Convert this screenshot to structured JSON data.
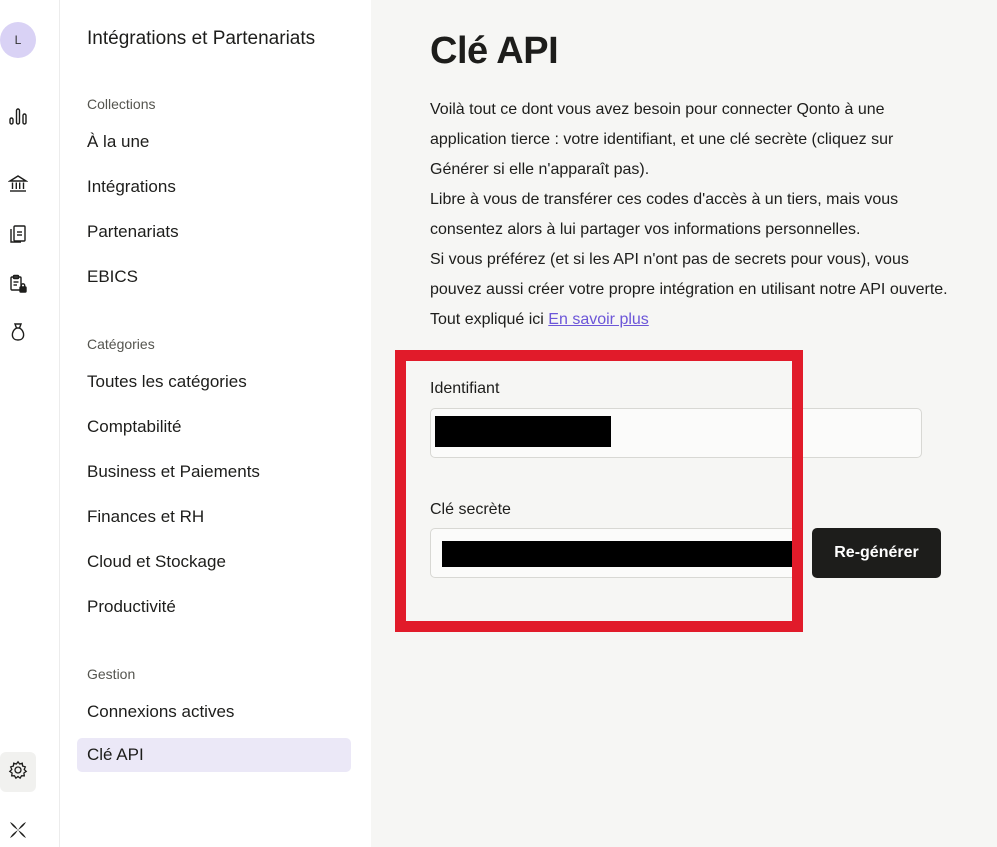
{
  "rail": {
    "avatar_initial": "L",
    "icons": [
      "bar-chart-icon",
      "bank-icon",
      "documents-icon",
      "locked-clipboard-icon",
      "money-bag-icon",
      "gear-icon",
      "qonto-logo-icon"
    ]
  },
  "nav": {
    "heading": "Intégrations et Partenariats",
    "sections": [
      {
        "title": "Collections",
        "items": [
          "À la une",
          "Intégrations",
          "Partenariats",
          "EBICS"
        ]
      },
      {
        "title": "Catégories",
        "items": [
          "Toutes les catégories",
          "Comptabilité",
          "Business et Paiements",
          "Finances et RH",
          "Cloud et Stockage",
          "Productivité"
        ]
      },
      {
        "title": "Gestion",
        "items": [
          "Connexions actives",
          "Clé API"
        ]
      }
    ],
    "active_item": "Clé API"
  },
  "main": {
    "title": "Clé API",
    "desc_line1": "Voilà tout ce dont vous avez besoin pour connecter Qonto à une application tierce : votre identifiant, et une clé secrète (cliquez sur Générer si elle n'apparaît pas).",
    "desc_line2": "Libre à vous de transférer ces codes d'accès à un tiers, mais vous consentez alors à lui partager vos informations personnelles.",
    "desc_line3": "Si vous préférez (et si les API n'ont pas de secrets pour vous), vous pouvez aussi créer votre propre intégration en utilisant notre API ouverte. Tout expliqué ici",
    "learn_more": "En savoir plus",
    "identifier_label": "Identifiant",
    "secret_label": "Clé secrète",
    "regenerate_label": "Re-générer"
  },
  "colors": {
    "accent": "#6c56d8",
    "highlight": "#e11b2a",
    "active_bg": "#ebe8f7",
    "button_bg": "#1d1d1b"
  }
}
